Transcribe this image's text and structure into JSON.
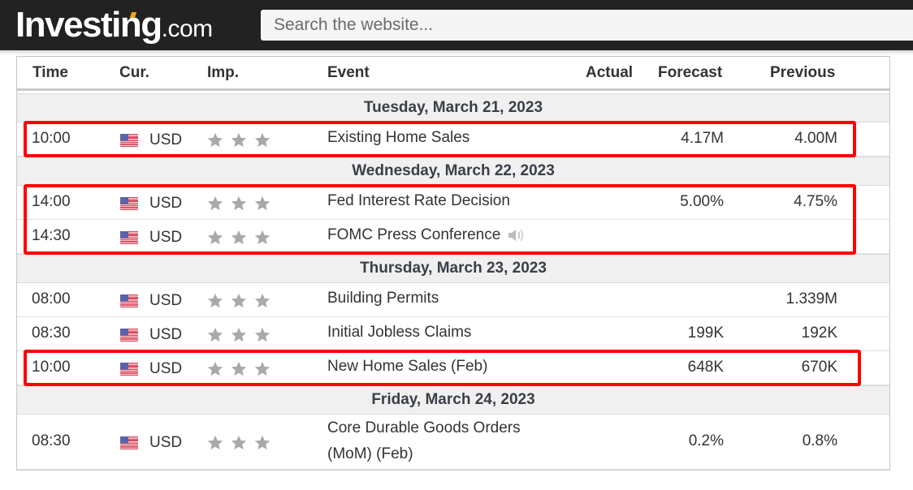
{
  "header": {
    "logo_main": "Investing",
    "logo_suffix": ".com",
    "search_placeholder": "Search the website..."
  },
  "table": {
    "columns": [
      "Time",
      "Cur.",
      "Imp.",
      "Event",
      "Actual",
      "Forecast",
      "Previous"
    ],
    "days": [
      {
        "label": "Tuesday, March 21, 2023",
        "events": [
          {
            "time": "10:00",
            "currency": "USD",
            "importance": 3,
            "event": "Existing Home Sales",
            "actual": "",
            "forecast": "4.17M",
            "previous": "4.00M",
            "highlighted": true
          }
        ]
      },
      {
        "label": "Wednesday, March 22, 2023",
        "events": [
          {
            "time": "14:00",
            "currency": "USD",
            "importance": 3,
            "event": "Fed Interest Rate Decision",
            "actual": "",
            "forecast": "5.00%",
            "previous": "4.75%",
            "highlighted": true
          },
          {
            "time": "14:30",
            "currency": "USD",
            "importance": 3,
            "event": "FOMC Press Conference",
            "actual": "",
            "forecast": "",
            "previous": "",
            "has_speech_icon": true,
            "highlighted": true
          }
        ]
      },
      {
        "label": "Thursday, March 23, 2023",
        "events": [
          {
            "time": "08:00",
            "currency": "USD",
            "importance": 3,
            "event": "Building Permits",
            "actual": "",
            "forecast": "",
            "previous": "1.339M",
            "highlighted": false
          },
          {
            "time": "08:30",
            "currency": "USD",
            "importance": 3,
            "event": "Initial Jobless Claims",
            "actual": "",
            "forecast": "199K",
            "previous": "192K",
            "highlighted": false
          },
          {
            "time": "10:00",
            "currency": "USD",
            "importance": 3,
            "event": "New Home Sales (Feb)",
            "actual": "",
            "forecast": "648K",
            "previous": "670K",
            "highlighted": true
          }
        ]
      },
      {
        "label": "Friday, March 24, 2023",
        "events": [
          {
            "time": "08:30",
            "currency": "USD",
            "importance": 3,
            "event_line1": "Core Durable Goods Orders",
            "event_line2": "(MoM) (Feb)",
            "event": "Core Durable Goods Orders (MoM) (Feb)",
            "actual": "",
            "forecast": "0.2%",
            "previous": "0.8%",
            "highlighted": false
          }
        ]
      }
    ]
  },
  "colors": {
    "topbar": "#222222",
    "logo_accent": "#f6a51a",
    "highlight_box": "#ff0000",
    "star": "#a9a9a9",
    "day_row_bg": "#f0f0f0"
  }
}
